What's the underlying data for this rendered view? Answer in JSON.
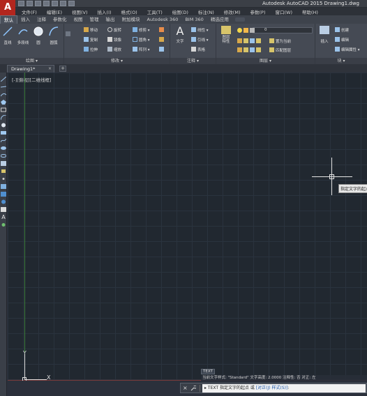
{
  "app": {
    "logo_letter": "A",
    "title": "Autodesk AutoCAD 2015    Drawing1.dwg"
  },
  "menubar": [
    "文件(F)",
    "编辑(E)",
    "视图(V)",
    "插入(I)",
    "格式(O)",
    "工具(T)",
    "绘图(D)",
    "标注(N)",
    "修改(M)",
    "参数(P)",
    "窗口(W)",
    "帮助(H)"
  ],
  "ribbon_tabs": [
    {
      "label": "默认",
      "active": true
    },
    {
      "label": "插入",
      "active": false
    },
    {
      "label": "注释",
      "active": false
    },
    {
      "label": "参数化",
      "active": false
    },
    {
      "label": "视图",
      "active": false
    },
    {
      "label": "管理",
      "active": false
    },
    {
      "label": "输出",
      "active": false
    },
    {
      "label": "附加模块",
      "active": false
    },
    {
      "label": "Autodesk 360",
      "active": false
    },
    {
      "label": "BIM 360",
      "active": false
    },
    {
      "label": "精选应用",
      "active": false
    }
  ],
  "panels": {
    "draw": {
      "footer": "绘图 ▾",
      "line": "直线",
      "polyline": "多段线",
      "circle": "圆",
      "arc": "圆弧"
    },
    "modify": {
      "footer": "修改 ▾",
      "move": "移动",
      "rotate": "旋转",
      "trim": "修剪 ▾",
      "copy": "复制",
      "mirror": "镜像",
      "fillet": "圆角 ▾",
      "stretch": "拉伸",
      "scale": "缩放",
      "array": "阵列 ▾"
    },
    "annotation": {
      "footer": "注释 ▾",
      "text": "文字",
      "linear": "线性 ▾",
      "leader": "引线 ▾",
      "table": "表格"
    },
    "layers": {
      "footer": "图层 ▾",
      "layer_props": "图层\n特性",
      "layer_value": "0",
      "set_current": "置为当前",
      "match_layer": "匹配图层"
    },
    "block": {
      "footer": "块 ▾",
      "insert": "插入",
      "create": "创建",
      "edit": "编辑",
      "edit_attrs": "编辑属性 ▾"
    }
  },
  "filetab": {
    "label": "Drawing1*",
    "close": "×",
    "add": "+"
  },
  "canvas": {
    "view_label": "[-][俯视][二维线框]",
    "tooltip": "指定文字的起点",
    "ucs_y": "Y",
    "ucs_x": "X",
    "text_badge": "TEXT"
  },
  "command": {
    "history": "当前文字样式: \"Standard\"  文字高度: 2.0000  注释性: 否  对正: 左",
    "close": "×",
    "prompt_prefix": "▸ TEXT 指定文字的起点 或 ",
    "options": "[对正(J) 样式(S)]",
    "suffix": ":"
  },
  "colors": {
    "canvas_bg": "#212830",
    "logo_red": "#b3261e",
    "ribbon_bg": "#454a54"
  }
}
